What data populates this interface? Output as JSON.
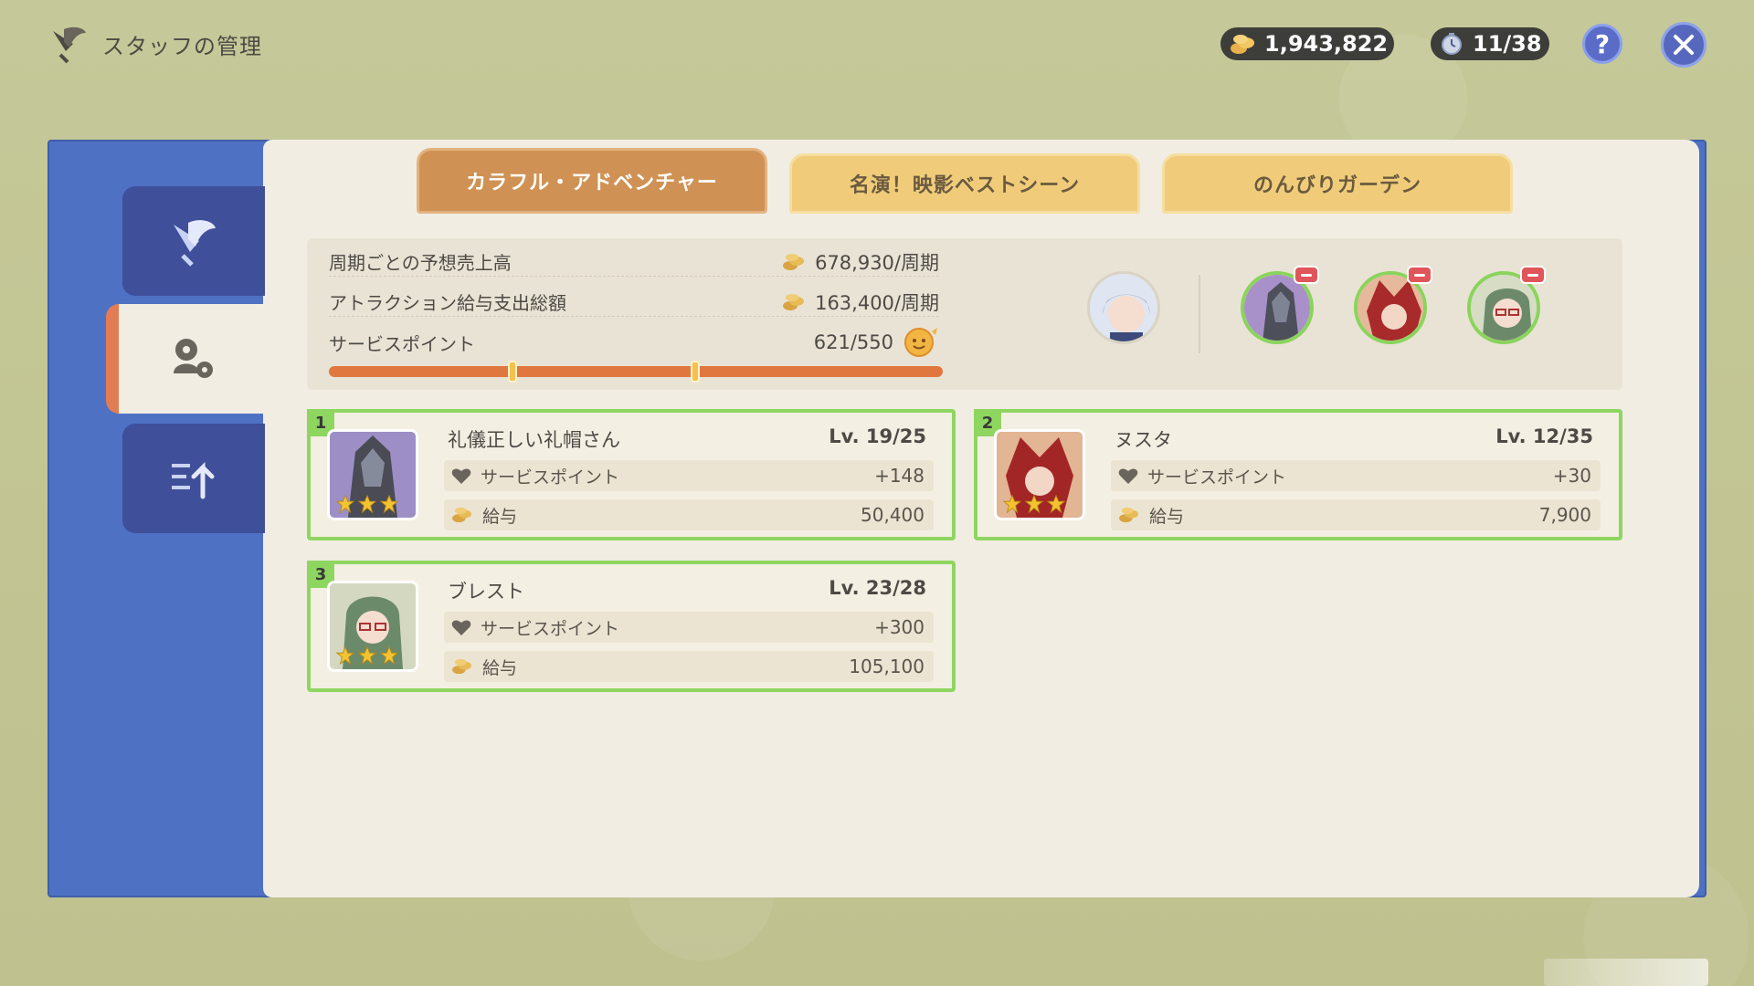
{
  "header": {
    "title": "スタッフの管理",
    "mora": "1,943,822",
    "time": "11/38",
    "help_label": "?"
  },
  "tabs": [
    {
      "label": "カラフル・アドベンチャー",
      "active": true
    },
    {
      "label": "名演！映影ベストシーン",
      "active": false
    },
    {
      "label": "のんびりガーデン",
      "active": false
    }
  ],
  "stats": {
    "revenue_label": "周期ごとの予想売上高",
    "revenue_value": "678,930/周期",
    "salary_label": "アトラクション給与支出総額",
    "salary_value": "163,400/周期",
    "sp_label": "サービスポイント",
    "sp_value": "621/550",
    "sp_progress": 1.0
  },
  "staff": [
    {
      "num": "1",
      "name": "礼儀正しい礼帽さん",
      "level": "Lv. 19/25",
      "sp_label": "サービスポイント",
      "sp": "+148",
      "salary_label": "給与",
      "salary": "50,400"
    },
    {
      "num": "2",
      "name": "ヌスタ",
      "level": "Lv. 12/35",
      "sp_label": "サービスポイント",
      "sp": "+30",
      "salary_label": "給与",
      "salary": "7,900"
    },
    {
      "num": "3",
      "name": "ブレスト",
      "level": "Lv. 23/28",
      "sp_label": "サービスポイント",
      "sp": "+300",
      "salary_label": "給与",
      "salary": "105,100"
    }
  ],
  "colors": {
    "accent_orange": "#e0773f",
    "card_border": "#8ed660",
    "frame_blue": "#4e71c4",
    "tab_active": "#cf9254",
    "tab_inactive": "#f0cc7a"
  },
  "icons": {
    "title": "quill-heart-icon",
    "mora": "coin-icon",
    "time": "stopwatch-icon",
    "help": "question-icon",
    "close": "close-icon",
    "sp": "heart-icon",
    "salary": "coin-icon"
  }
}
